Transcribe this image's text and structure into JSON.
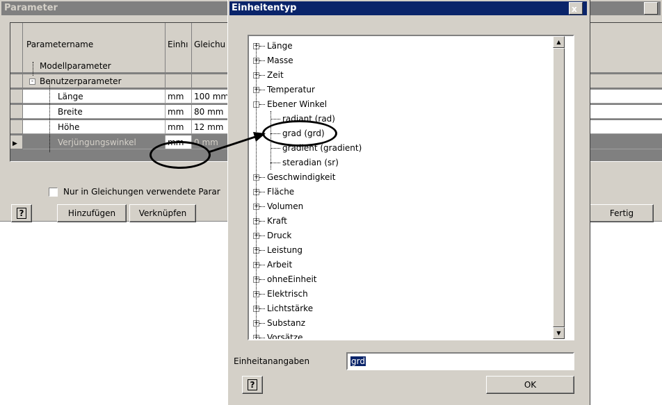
{
  "param_dialog": {
    "title": "Parameter",
    "columns": [
      "Parametername",
      "Einhı",
      "Gleichu"
    ],
    "rows": [
      {
        "name": "Modellparameter",
        "unit": "",
        "equation": ""
      },
      {
        "name": "Benutzerparameter",
        "unit": "",
        "equation": ""
      },
      {
        "name": "Länge",
        "unit": "mm",
        "equation": "100 mm"
      },
      {
        "name": "Breite",
        "unit": "mm",
        "equation": "80 mm"
      },
      {
        "name": "Höhe",
        "unit": "mm",
        "equation": "12 mm"
      },
      {
        "name": "Verjüngungswinkel",
        "unit": "mm",
        "equation": "0 mm"
      }
    ],
    "checkbox_label": "Nur in Gleichungen verwendete Parar",
    "help_label": "?",
    "add_label": "Hinzufügen",
    "link_label": "Verknüpfen",
    "done_label": "Fertig",
    "close_label": "x"
  },
  "unit_dialog": {
    "title": "Einheitentyp",
    "close_label": "x",
    "tree": [
      {
        "label": "Länge",
        "level": 0,
        "expander": "+"
      },
      {
        "label": "Masse",
        "level": 0,
        "expander": "+"
      },
      {
        "label": "Zeit",
        "level": 0,
        "expander": "+"
      },
      {
        "label": "Temperatur",
        "level": 0,
        "expander": "+"
      },
      {
        "label": "Ebener Winkel",
        "level": 0,
        "expander": "-"
      },
      {
        "label": "radiant (rad)",
        "level": 1,
        "expander": ""
      },
      {
        "label": "grad (grd)",
        "level": 1,
        "expander": ""
      },
      {
        "label": "gradient (gradient)",
        "level": 1,
        "expander": ""
      },
      {
        "label": "steradian (sr)",
        "level": 1,
        "expander": ""
      },
      {
        "label": "Geschwindigkeit",
        "level": 0,
        "expander": "+"
      },
      {
        "label": "Fläche",
        "level": 0,
        "expander": "+"
      },
      {
        "label": "Volumen",
        "level": 0,
        "expander": "+"
      },
      {
        "label": "Kraft",
        "level": 0,
        "expander": "+"
      },
      {
        "label": "Druck",
        "level": 0,
        "expander": "+"
      },
      {
        "label": "Leistung",
        "level": 0,
        "expander": "+"
      },
      {
        "label": "Arbeit",
        "level": 0,
        "expander": "+"
      },
      {
        "label": "ohneEinheit",
        "level": 0,
        "expander": "+"
      },
      {
        "label": "Elektrisch",
        "level": 0,
        "expander": "+"
      },
      {
        "label": "Lichtstärke",
        "level": 0,
        "expander": "+"
      },
      {
        "label": "Substanz",
        "level": 0,
        "expander": "+"
      },
      {
        "label": "Vorsätze",
        "level": 0,
        "expander": "+"
      }
    ],
    "input_label": "Einheitanangaben",
    "input_value": "grd",
    "help_label": "?",
    "ok_label": "OK"
  }
}
